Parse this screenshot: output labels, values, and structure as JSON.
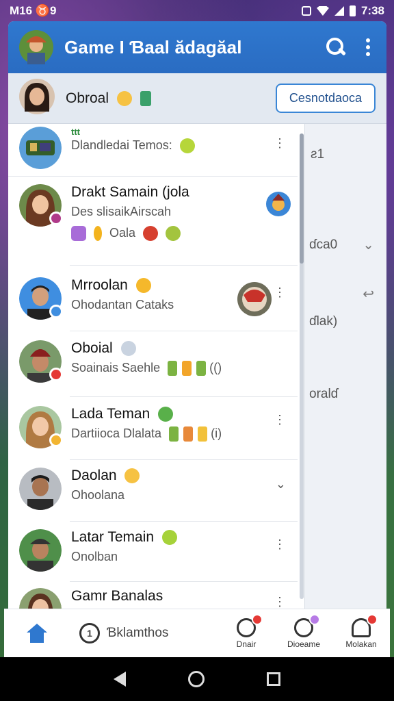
{
  "status_bar": {
    "time_left": "M16 ♉9",
    "time_right": "7:38"
  },
  "app": {
    "title": "Game I Ɓaal ădagăal"
  },
  "profile": {
    "name": "Obroal",
    "button": "Cesnotdaoca"
  },
  "chats": [
    {
      "name": "ttt",
      "message": "Dlandledai Temos:",
      "meta": "⋮"
    },
    {
      "name": "Drakt Samain (jola",
      "message": "Des slisaikAirscah",
      "extra": "Oala",
      "meta": ""
    },
    {
      "name": "Mrroolan",
      "message": "Ohodantan Cataks",
      "meta": "⋮"
    },
    {
      "name": "Oboial",
      "message": "Soainais Saehle",
      "extra": "(()",
      "meta": ""
    },
    {
      "name": "Lada Teman",
      "message": "Dartiioca Dlalata",
      "extra": "(i)",
      "meta": "⋮"
    },
    {
      "name": "Daolan",
      "message": "Ohoolana",
      "meta": "⌄"
    },
    {
      "name": "Latar Temain",
      "message": "Onolban",
      "meta": "⋮"
    },
    {
      "name": "Gamr Banalas",
      "message": "",
      "meta": "⋮"
    }
  ],
  "right_panel": {
    "items": [
      "ƨ1",
      "ɗca0",
      "ɗlak)",
      "oralɗ"
    ]
  },
  "bottom_nav": {
    "search_label": "Ɓklamthos",
    "items": [
      {
        "label": "Dnair"
      },
      {
        "label": "Dioeame"
      },
      {
        "label": "Molakan"
      }
    ]
  },
  "colors": {
    "brand": "#2f78cf",
    "badge_red": "#e53935"
  }
}
